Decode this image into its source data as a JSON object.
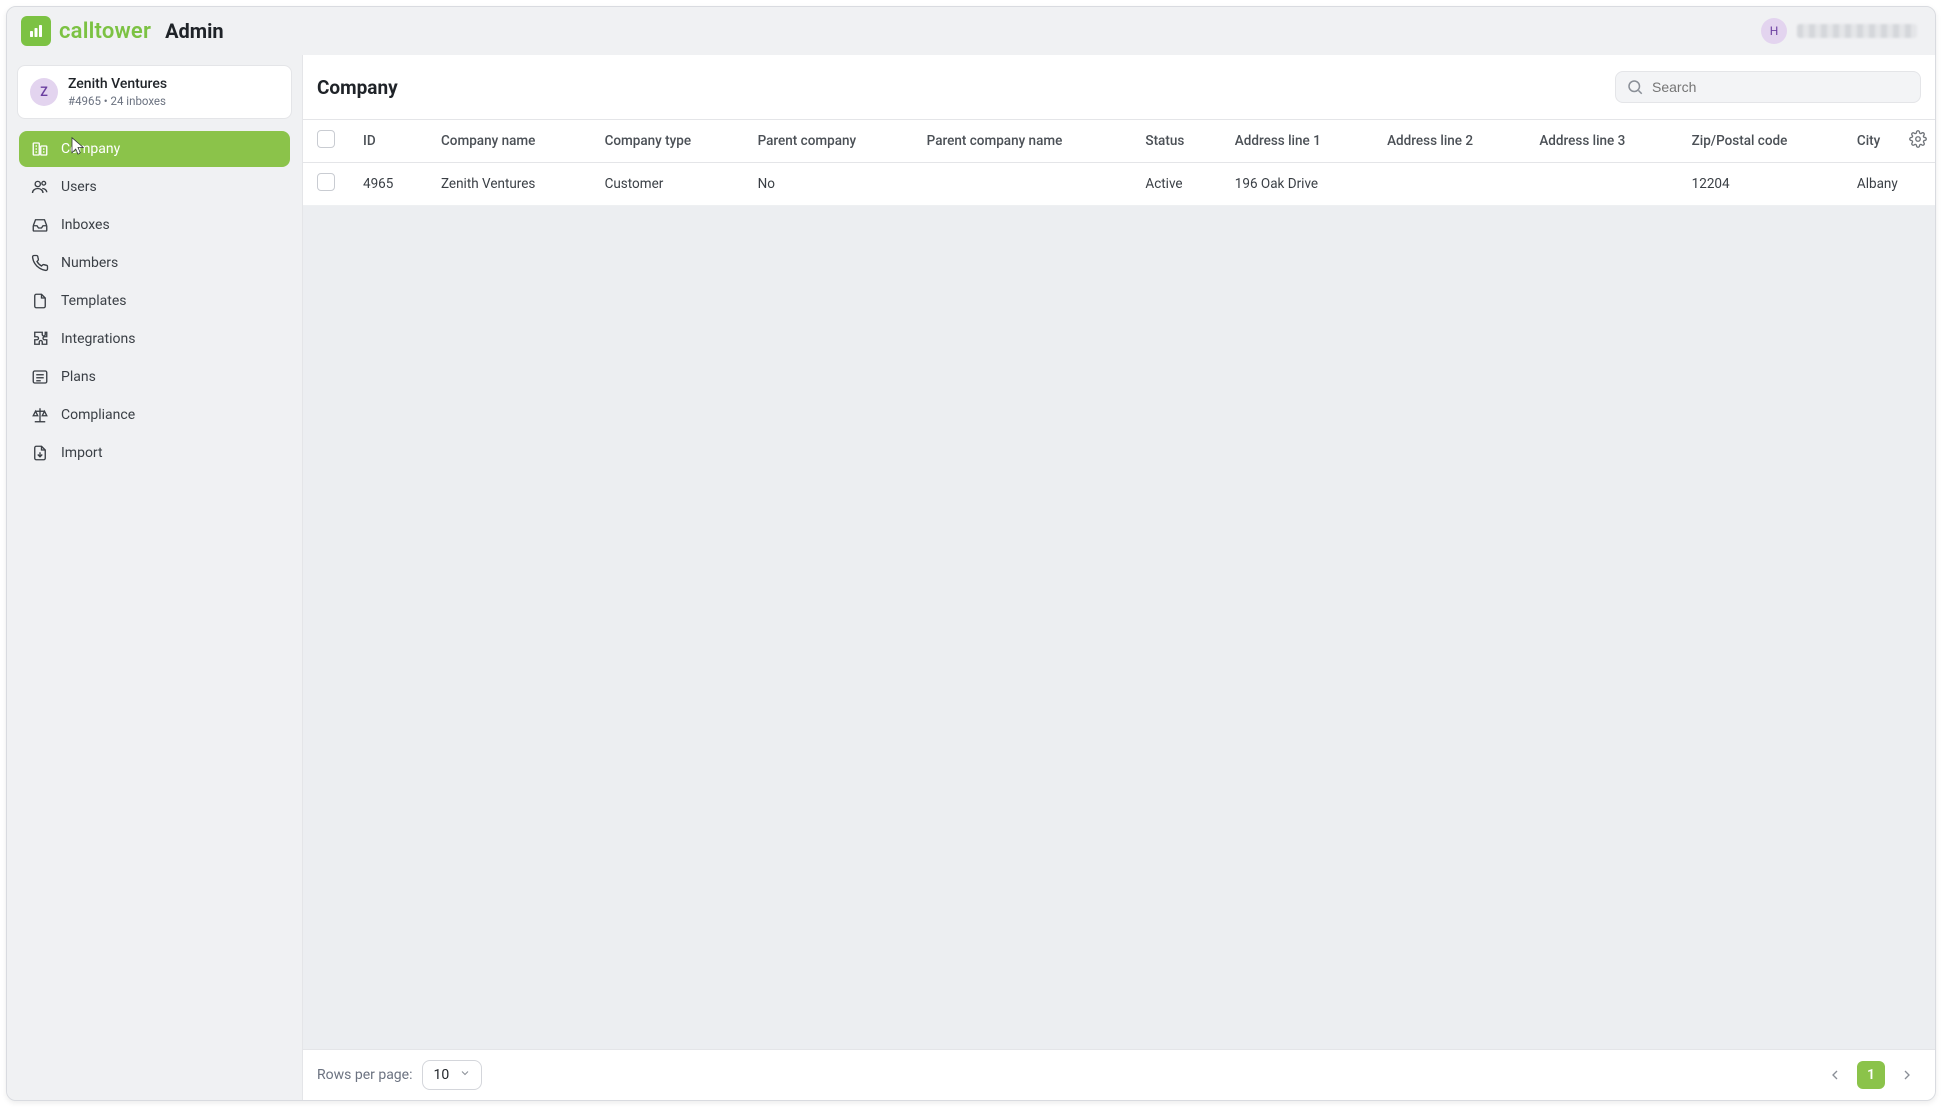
{
  "brand": {
    "name": "calltower"
  },
  "app_title": "Admin",
  "header_user": {
    "initial": "H"
  },
  "account": {
    "avatar_initial": "Z",
    "name": "Zenith Ventures",
    "meta": "#4965 • 24 inboxes"
  },
  "sidebar": {
    "items": [
      {
        "label": "Company",
        "icon": "business-icon",
        "active": true
      },
      {
        "label": "Users",
        "icon": "users-icon",
        "active": false
      },
      {
        "label": "Inboxes",
        "icon": "inbox-icon",
        "active": false
      },
      {
        "label": "Numbers",
        "icon": "phone-icon",
        "active": false
      },
      {
        "label": "Templates",
        "icon": "document-icon",
        "active": false
      },
      {
        "label": "Integrations",
        "icon": "puzzle-icon",
        "active": false
      },
      {
        "label": "Plans",
        "icon": "list-icon",
        "active": false
      },
      {
        "label": "Compliance",
        "icon": "balance-icon",
        "active": false
      },
      {
        "label": "Import",
        "icon": "import-icon",
        "active": false
      }
    ]
  },
  "page": {
    "title": "Company",
    "search_placeholder": "Search"
  },
  "table": {
    "columns": [
      "ID",
      "Company name",
      "Company type",
      "Parent company",
      "Parent company name",
      "Status",
      "Address line 1",
      "Address line 2",
      "Address line 3",
      "Zip/Postal code",
      "City"
    ],
    "rows": [
      {
        "id": "4965",
        "company_name": "Zenith Ventures",
        "company_type": "Customer",
        "parent_company": "No",
        "parent_company_name": "",
        "status": "Active",
        "address1": "196 Oak Drive",
        "address2": "",
        "address3": "",
        "zip": "12204",
        "city": "Albany"
      }
    ]
  },
  "pagination": {
    "rows_per_page_label": "Rows per page:",
    "rows_per_page_value": "10",
    "current_page": "1"
  }
}
